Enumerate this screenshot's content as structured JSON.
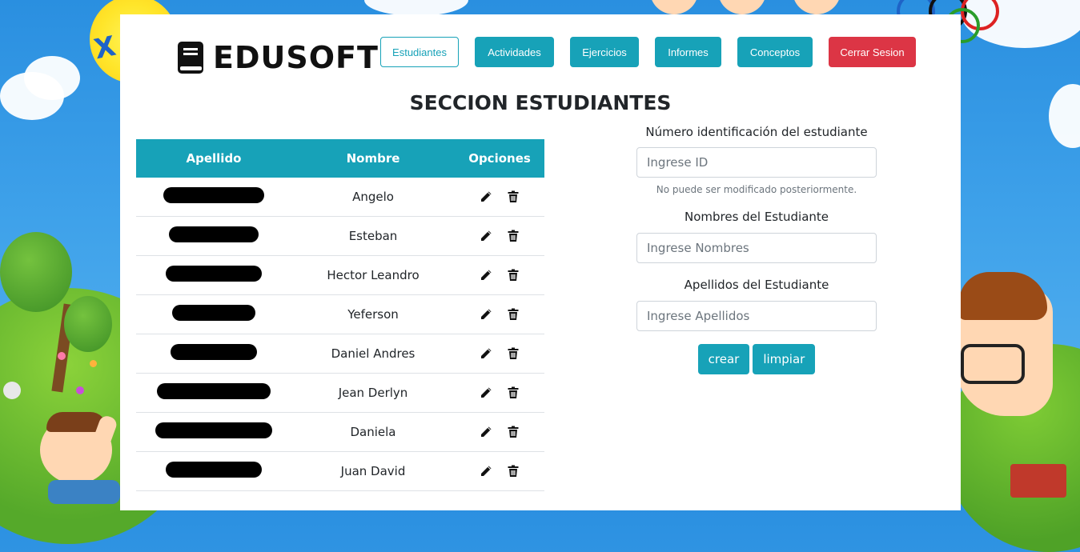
{
  "brand": {
    "name": "EDUSOFT",
    "icon": "book-icon"
  },
  "nav": {
    "estudiantes": "Estudiantes",
    "actividades": "Actividades",
    "ejercicios": "Ejercicios",
    "informes": "Informes",
    "conceptos": "Conceptos",
    "cerrar": "Cerrar Sesion"
  },
  "section_title": "SECCION ESTUDIANTES",
  "table": {
    "headers": {
      "apellido": "Apellido",
      "nombre": "Nombre",
      "opciones": "Opciones"
    },
    "rows": [
      {
        "nombre": "Angelo"
      },
      {
        "nombre": "Esteban"
      },
      {
        "nombre": "Hector Leandro"
      },
      {
        "nombre": "Yeferson"
      },
      {
        "nombre": "Daniel Andres"
      },
      {
        "nombre": "Jean Derlyn"
      },
      {
        "nombre": "Daniela"
      },
      {
        "nombre": "Juan David"
      }
    ],
    "icons": {
      "edit": "pencil-icon",
      "delete": "trash-icon"
    }
  },
  "form": {
    "id_label": "Número identificación del estudiante",
    "id_placeholder": "Ingrese ID",
    "id_help": "No puede ser modificado posteriormente.",
    "nombres_label": "Nombres del Estudiante",
    "nombres_placeholder": "Ingrese Nombres",
    "apellidos_label": "Apellidos del Estudiante",
    "apellidos_placeholder": "Ingrese Apellidos",
    "crear": "crear",
    "limpiar": "limpiar"
  },
  "colors": {
    "primary": "#17a2b8",
    "danger": "#dc3545"
  }
}
